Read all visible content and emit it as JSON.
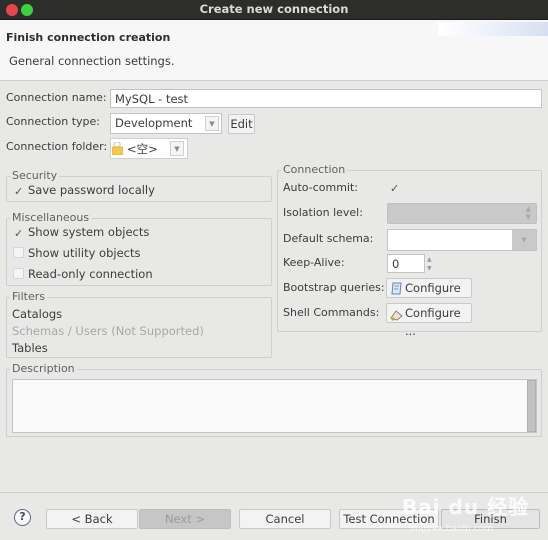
{
  "window": {
    "title": "Create new connection",
    "controls": [
      "close",
      "maximize"
    ]
  },
  "header": {
    "title": "Finish connection creation",
    "subtitle": "General connection settings."
  },
  "general": {
    "connection_name_label": "Connection name:",
    "connection_name_value": "MySQL - test",
    "connection_type_label": "Connection type:",
    "connection_type_value": "Development",
    "edit_label": "Edit",
    "connection_folder_label": "Connection folder:",
    "connection_folder_value": "<空>"
  },
  "security": {
    "title": "Security",
    "save_password": {
      "label": "Save password locally",
      "checked": true
    }
  },
  "misc": {
    "title": "Miscellaneous",
    "items": [
      {
        "label": "Show system objects",
        "checked": true
      },
      {
        "label": "Show utility objects",
        "checked": false
      },
      {
        "label": "Read-only connection",
        "checked": false
      }
    ]
  },
  "filters": {
    "title": "Filters",
    "items": [
      {
        "label": "Catalogs",
        "enabled": true
      },
      {
        "label": "Schemas / Users (Not Supported)",
        "enabled": false
      },
      {
        "label": "Tables",
        "enabled": true
      }
    ]
  },
  "connection": {
    "title": "Connection",
    "auto_commit_label": "Auto-commit:",
    "auto_commit_checked": true,
    "isolation_label": "Isolation level:",
    "isolation_value": "",
    "default_schema_label": "Default schema:",
    "default_schema_value": "",
    "keep_alive_label": "Keep-Alive:",
    "keep_alive_value": "0",
    "bootstrap_label": "Bootstrap queries:",
    "bootstrap_button": "Configure ...",
    "shell_label": "Shell Commands:",
    "shell_button": "Configure ..."
  },
  "description": {
    "title": "Description",
    "value": ""
  },
  "footer": {
    "help": "?",
    "back": "< Back",
    "next": "Next >",
    "cancel": "Cancel",
    "test_connection": "Test Connection ...",
    "finish": "Finish"
  },
  "watermark": {
    "text": "Bai du 经验",
    "sub": "jingyan.baidu.com"
  },
  "check_glyph": "✓"
}
